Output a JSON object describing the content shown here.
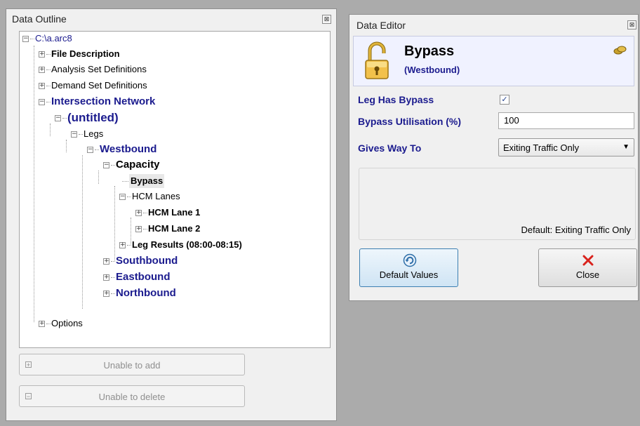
{
  "outline": {
    "title": "Data Outline",
    "tree": {
      "root": "C:\\a.arc8",
      "file_description": "File Description",
      "analysis_sets": "Analysis Set Definitions",
      "demand_sets": "Demand Set Definitions",
      "intersection_network": "Intersection Network",
      "untitled": "(untitled)",
      "legs": "Legs",
      "westbound": "Westbound",
      "capacity": "Capacity",
      "bypass": "Bypass",
      "hcm_lanes": "HCM Lanes",
      "hcm_lane_1": "HCM Lane 1",
      "hcm_lane_2": "HCM Lane 2",
      "leg_results": "Leg Results (08:00-08:15)",
      "southbound": "Southbound",
      "eastbound": "Eastbound",
      "northbound": "Northbound",
      "options": "Options"
    },
    "add_button": "Unable to add",
    "delete_button": "Unable to delete"
  },
  "editor": {
    "title": "Data Editor",
    "header_title": "Bypass",
    "header_subtitle": "(Westbound)",
    "fields": {
      "leg_has_bypass_label": "Leg Has Bypass",
      "leg_has_bypass_checked": true,
      "bypass_util_label": "Bypass Utilisation (%)",
      "bypass_util_value": "100",
      "gives_way_label": "Gives Way To",
      "gives_way_value": "Exiting Traffic Only"
    },
    "description": "Default: Exiting Traffic Only",
    "default_button": "Default Values",
    "close_button": "Close"
  },
  "icons": [
    "expand-box-icon",
    "collapse-box-icon",
    "lock-open-icon",
    "coins-icon",
    "undo-icon",
    "close-x-icon",
    "checkbox-checked-icon",
    "dropdown-arrow-icon"
  ],
  "colors": {
    "node_blue": "#1b1b8e",
    "close_red": "#d9221c",
    "header_bg": "#f0f2ff"
  }
}
